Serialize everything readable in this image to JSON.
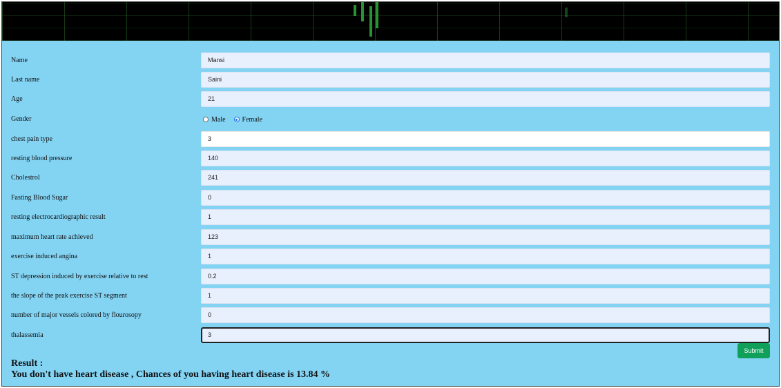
{
  "fields": [
    {
      "label": "Name",
      "value": "Mansi"
    },
    {
      "label": "Last name",
      "value": "Saini"
    },
    {
      "label": "Age",
      "value": "21"
    },
    {
      "label": "chest pain type",
      "value": "3"
    },
    {
      "label": "resting blood pressure",
      "value": "140"
    },
    {
      "label": "Cholestrol",
      "value": "241"
    },
    {
      "label": "Fasting Blood Sugar",
      "value": "0"
    },
    {
      "label": "resting electrocardiographic result",
      "value": "1"
    },
    {
      "label": "maximum heart rate achieved",
      "value": "123"
    },
    {
      "label": "exercise induced angina",
      "value": "1"
    },
    {
      "label": "ST depression induced by exercise relative to rest",
      "value": "0.2"
    },
    {
      "label": "the slope of the peak exercise ST segment",
      "value": "1"
    },
    {
      "label": "number of major vessels colored by flourosopy",
      "value": "0"
    },
    {
      "label": "thalassemia",
      "value": "3"
    }
  ],
  "gender": {
    "label": "Gender",
    "options": [
      {
        "label": "Male",
        "checked": false
      },
      {
        "label": "Female",
        "checked": true
      }
    ]
  },
  "submit_label": "Submit",
  "result": {
    "title": "Result :",
    "text": "You don't have heart disease , Chances of you having heart disease is 13.84 %"
  },
  "colors": {
    "background": "#83d3f3",
    "input": "#e8f0fe",
    "submit": "#11a05a",
    "banner": "#000000"
  }
}
